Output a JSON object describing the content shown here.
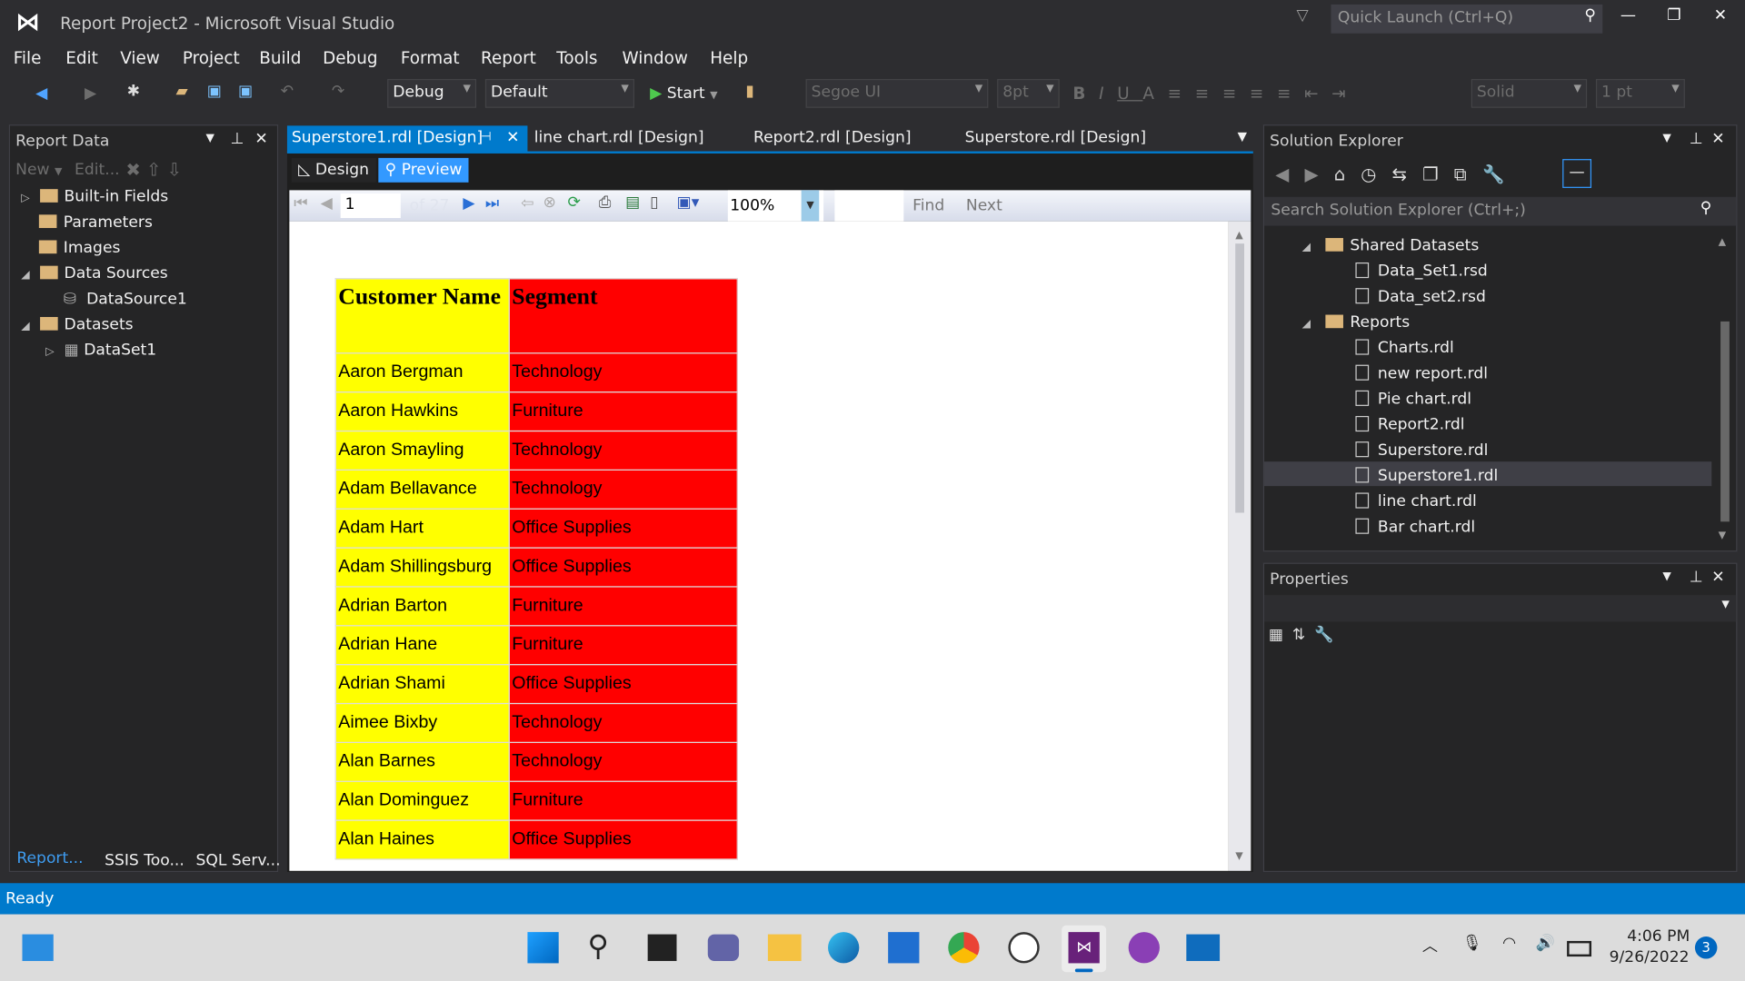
{
  "window": {
    "title": "Report Project2 - Microsoft Visual Studio",
    "quick_launch": "Quick Launch (Ctrl+Q)"
  },
  "menu": [
    "File",
    "Edit",
    "View",
    "Project",
    "Build",
    "Debug",
    "Format",
    "Report",
    "Tools",
    "Window",
    "Help"
  ],
  "toolbar": {
    "config": "Debug",
    "platform": "Default",
    "start": "Start",
    "font": "Segoe UI",
    "size": "8pt",
    "border_style": "Solid",
    "border_width": "1 pt"
  },
  "report_data": {
    "title": "Report Data",
    "new": "New",
    "edit": "Edit...",
    "items": [
      "Built-in Fields",
      "Parameters",
      "Images",
      "Data Sources",
      "DataSource1",
      "Datasets",
      "DataSet1"
    ]
  },
  "bottom_tabs": [
    "Report...",
    "SSIS Too...",
    "SQL Serv..."
  ],
  "doc_tabs": [
    "Superstore1.rdl [Design]",
    "line chart.rdl [Design]",
    "Report2.rdl [Design]",
    "Superstore.rdl [Design]"
  ],
  "view_tabs": {
    "design": "Design",
    "preview": "Preview"
  },
  "report_toolbar": {
    "page": "1",
    "of": "of 27",
    "zoom": "100%",
    "find": "Find",
    "next": "Next"
  },
  "report": {
    "headers": [
      "Customer Name",
      "Segment"
    ],
    "rows": [
      [
        "Aaron Bergman",
        "Technology"
      ],
      [
        "Aaron Hawkins",
        "Furniture"
      ],
      [
        "Aaron Smayling",
        "Technology"
      ],
      [
        "Adam Bellavance",
        "Technology"
      ],
      [
        "Adam Hart",
        "Office Supplies"
      ],
      [
        "Adam Shillingsburg",
        "Office Supplies"
      ],
      [
        "Adrian Barton",
        "Furniture"
      ],
      [
        "Adrian Hane",
        "Furniture"
      ],
      [
        "Adrian Shami",
        "Office Supplies"
      ],
      [
        "Aimee Bixby",
        "Technology"
      ],
      [
        "Alan Barnes",
        "Technology"
      ],
      [
        "Alan Dominguez",
        "Furniture"
      ],
      [
        "Alan Haines",
        "Office Supplies"
      ]
    ]
  },
  "solution_explorer": {
    "title": "Solution Explorer",
    "search": "Search Solution Explorer (Ctrl+;)",
    "shared_datasets": "Shared Datasets",
    "datasets": [
      "Data_Set1.rsd",
      "Data_set2.rsd"
    ],
    "reports_folder": "Reports",
    "reports": [
      "Charts.rdl",
      "new report.rdl",
      "Pie chart.rdl",
      "Report2.rdl",
      "Superstore.rdl",
      "Superstore1.rdl",
      "line chart.rdl",
      "Bar chart.rdl"
    ],
    "selected": "Superstore1.rdl"
  },
  "properties": {
    "title": "Properties"
  },
  "status": {
    "text": "Ready"
  },
  "taskbar": {
    "time": "4:06 PM",
    "date": "9/26/2022",
    "notifications": "3"
  }
}
